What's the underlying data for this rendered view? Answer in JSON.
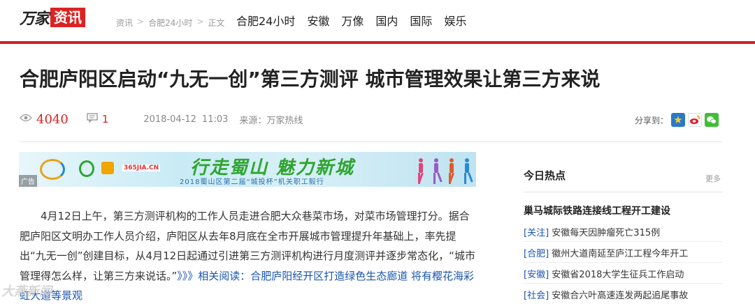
{
  "logo": {
    "part1": "万家",
    "part2": "资讯"
  },
  "breadcrumb": {
    "items": [
      "资讯",
      "合肥24小时",
      "正文"
    ],
    "sep": ">"
  },
  "nav": [
    "合肥24小时",
    "安徽",
    "万像",
    "国内",
    "国际",
    "娱乐"
  ],
  "article": {
    "title": "合肥庐阳区启动“九无一创”第三方测评 城市管理效果让第三方来说",
    "views": "4040",
    "comments": "1",
    "date": "2018-04-12",
    "time": "11:03",
    "source": "来源：万家热线",
    "share_label": "分享到：",
    "body_text": "4月12日上午，第三方测评机构的工作人员走进合肥大众巷菜市场，对菜市场管理打分。据合肥庐阳区文明办工作人员介绍，庐阳区从去年8月底在全市开展城市管理提升年基础上，率先提出“九无一创”创建目标，从4月12日起通过引进第三方测评机构进行月度测评并逐步常态化，“城市管理得怎么样，让第三方来说话。”",
    "related": "》》》相关阅读：合肥庐阳经开区打造绿色生态廊道 将有樱花海彩虹大道等景观"
  },
  "ad": {
    "tag": "广告",
    "headline": "行走蜀山 魅力新城",
    "subline": "2018蜀山区第二届“城投杯”机关职工毅行",
    "brand": "365JIA.CN"
  },
  "sidebar": {
    "title": "今日热点",
    "more": "更多",
    "top": "巢马城际铁路连接线工程开工建设",
    "items": [
      {
        "cat": "[关注]",
        "text": "安徽每天因肿瘤死亡315例"
      },
      {
        "cat": "[合肥]",
        "text": "徽州大道南延至庐江工程今年开工"
      },
      {
        "cat": "[安徽]",
        "text": "安徽省2018大学生征兵工作启动"
      },
      {
        "cat": "[社会]",
        "text": "安徽合六叶高速连发两起追尾事故"
      }
    ]
  },
  "watermark": "大燕新闻",
  "colors": {
    "accent": "#d42020",
    "link": "#1a55b0"
  }
}
